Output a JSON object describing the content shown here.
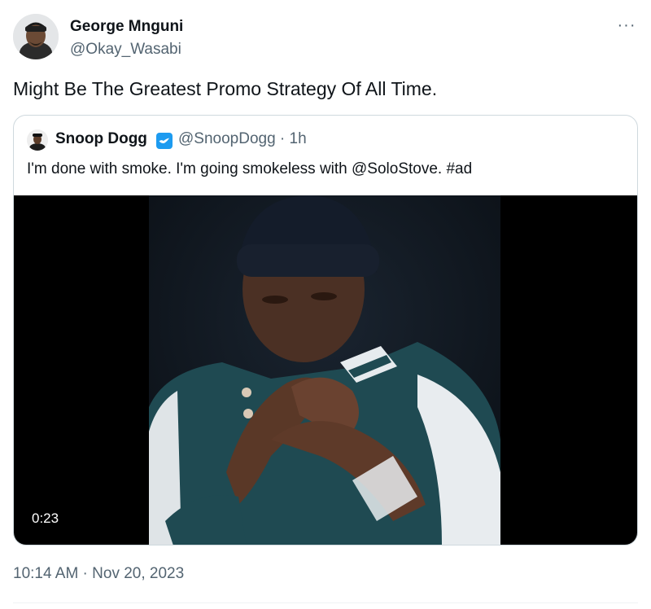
{
  "author": {
    "name": "George Mnguni",
    "handle": "@Okay_Wasabi"
  },
  "more_label": "···",
  "tweet_text": "Might Be The Greatest Promo Strategy Of All Time.",
  "quote": {
    "name": "Snoop Dogg",
    "meta": "@SnoopDogg · 1h",
    "text": "I'm done with smoke. I'm going smokeless with @SoloStove. #ad",
    "verified_color": "#1d9bf0",
    "video_duration": "0:23"
  },
  "timestamp": "10:14 AM · Nov 20, 2023",
  "icons": {
    "more": "ellipsis-icon",
    "verified": "verified-badge-icon"
  }
}
